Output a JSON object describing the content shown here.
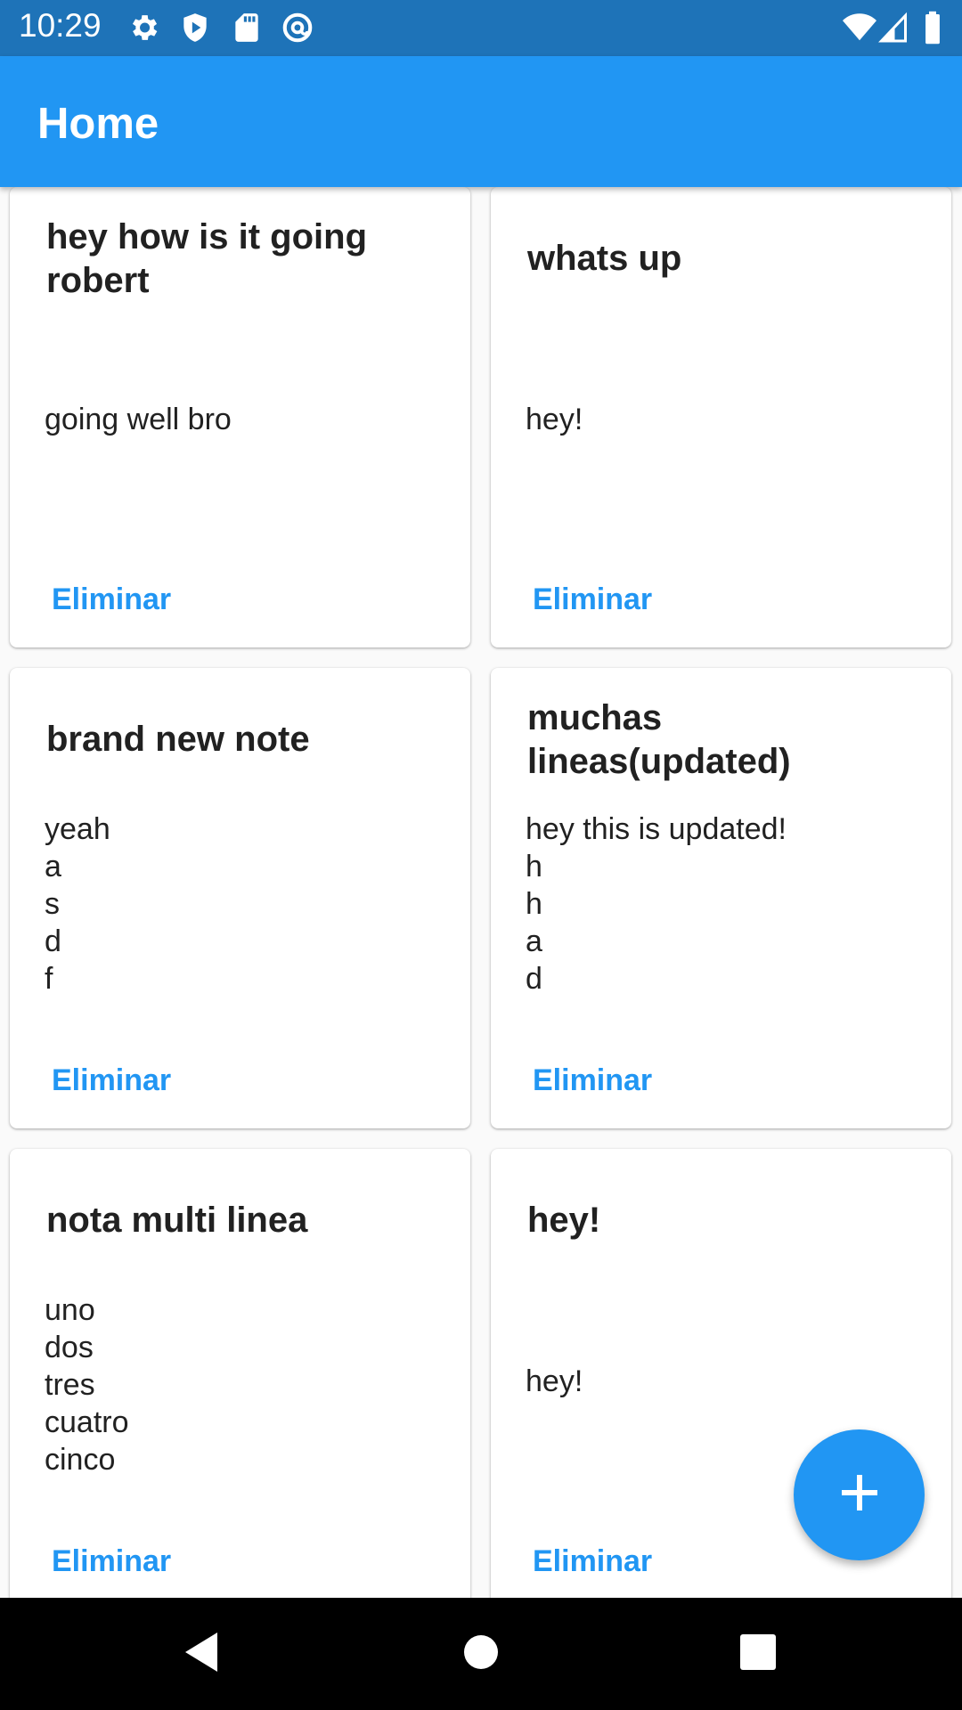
{
  "status_bar": {
    "time": "10:29",
    "icons_left": [
      "gear-icon",
      "shield-icon",
      "sd-card-icon",
      "at-sign-icon"
    ],
    "icons_right": [
      "wifi-icon",
      "cell-signal-icon",
      "battery-icon"
    ]
  },
  "app_bar": {
    "title": "Home"
  },
  "notes": [
    {
      "title": "hey how is it going robert",
      "body": "going well bro",
      "action": "Eliminar"
    },
    {
      "title": "whats up",
      "body": "hey!",
      "action": "Eliminar"
    },
    {
      "title": "brand new note",
      "body": "yeah\na\ns\nd\nf",
      "action": "Eliminar"
    },
    {
      "title": "muchas lineas(updated)",
      "body": "hey this is updated!\nh\nh\na\nd",
      "action": "Eliminar"
    },
    {
      "title": "nota multi linea",
      "body": "uno\ndos\ntres\ncuatro\ncinco",
      "action": "Eliminar"
    },
    {
      "title": "hey!",
      "body": "hey!",
      "action": "Eliminar"
    }
  ],
  "fab": {
    "icon": "plus-icon"
  },
  "nav_bar": {
    "icons": [
      "back-icon",
      "home-icon",
      "recents-icon"
    ]
  },
  "colors": {
    "primary": "#2196f3",
    "status_bar": "#1e73b8"
  }
}
